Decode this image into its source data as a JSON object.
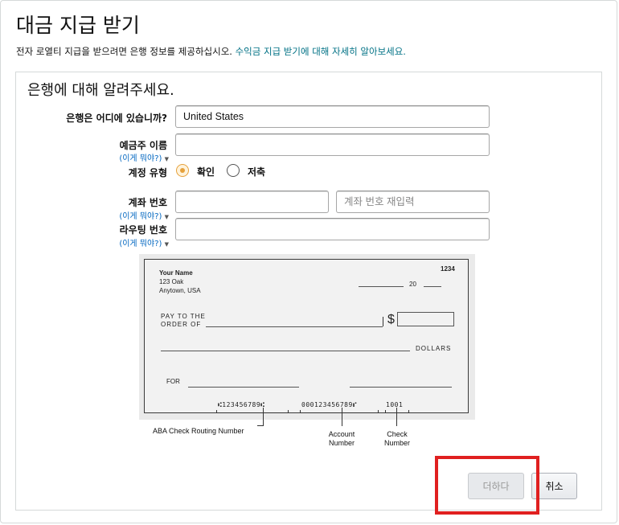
{
  "page": {
    "title": "대금 지급 받기",
    "subtitle_text": "전자 로열티 지급을 받으려면 은행 정보를 제공하십시오. ",
    "subtitle_link": "수익금 지급 받기에 대해 자세히 알아보세요."
  },
  "form": {
    "section_title": "은행에 대해 알려주세요.",
    "bank_location": {
      "label": "은행은 어디에 있습니까?",
      "value": "United States"
    },
    "account_holder": {
      "label": "예금주 이름",
      "help": "(이게 뭐야?)",
      "value": ""
    },
    "account_type": {
      "label": "계정 유형",
      "options": [
        {
          "label": "확인",
          "checked": true
        },
        {
          "label": "저축",
          "checked": false
        }
      ]
    },
    "account_number": {
      "label": "계좌 번호",
      "help": "(이게 뭐야?)",
      "value": "",
      "confirm_placeholder": "계좌 번호 재입력"
    },
    "routing_number": {
      "label": "라우팅 번호",
      "help": "(이게 뭐야?)",
      "value": ""
    }
  },
  "check_image": {
    "name": "Your Name",
    "address1": "123 Oak",
    "address2": "Anytown, USA",
    "check_no": "1234",
    "date_prefix": "20",
    "pay_to_line1": "PAY TO THE",
    "pay_to_line2": "ORDER OF",
    "dollar_sign": "$",
    "dollars": "DOLLARS",
    "for": "FOR",
    "micr_routing": "⑆123456789⑆",
    "micr_account": "000123456789⑈",
    "micr_check": "1001",
    "caption_routing": "ABA Check Routing Number",
    "caption_account_line1": "Account",
    "caption_account_line2": "Number",
    "caption_check_line1": "Check",
    "caption_check_line2": "Number"
  },
  "buttons": {
    "add": "더하다",
    "cancel": "취소"
  },
  "colors": {
    "link": "#007185",
    "help_link": "#0066c0",
    "radio_accent": "#e6a13b",
    "highlight": "#e02020"
  }
}
